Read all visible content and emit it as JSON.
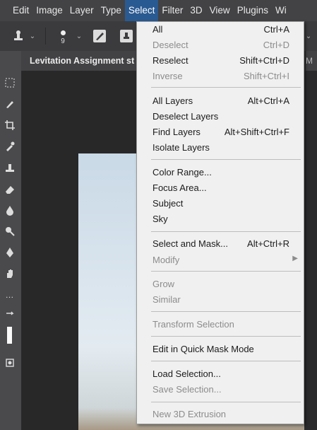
{
  "menubar": {
    "items": [
      "Edit",
      "Image",
      "Layer",
      "Type",
      "Select",
      "Filter",
      "3D",
      "View",
      "Plugins",
      "Wi"
    ],
    "active": "Select"
  },
  "options_bar": {
    "brush_size": "9"
  },
  "document": {
    "tab_title": "Levitation Assignment st",
    "tab_right": "M"
  },
  "select_menu": {
    "items": [
      {
        "label": "All",
        "shortcut": "Ctrl+A",
        "enabled": true
      },
      {
        "label": "Deselect",
        "shortcut": "Ctrl+D",
        "enabled": false
      },
      {
        "label": "Reselect",
        "shortcut": "Shift+Ctrl+D",
        "enabled": true
      },
      {
        "label": "Inverse",
        "shortcut": "Shift+Ctrl+I",
        "enabled": false
      },
      {
        "label": "All Layers",
        "shortcut": "Alt+Ctrl+A",
        "enabled": true
      },
      {
        "label": "Deselect Layers",
        "shortcut": "",
        "enabled": true
      },
      {
        "label": "Find Layers",
        "shortcut": "Alt+Shift+Ctrl+F",
        "enabled": true
      },
      {
        "label": "Isolate Layers",
        "shortcut": "",
        "enabled": true
      },
      {
        "label": "Color Range...",
        "shortcut": "",
        "enabled": true
      },
      {
        "label": "Focus Area...",
        "shortcut": "",
        "enabled": true
      },
      {
        "label": "Subject",
        "shortcut": "",
        "enabled": true
      },
      {
        "label": "Sky",
        "shortcut": "",
        "enabled": true
      },
      {
        "label": "Select and Mask...",
        "shortcut": "Alt+Ctrl+R",
        "enabled": true
      },
      {
        "label": "Modify",
        "shortcut": "",
        "enabled": false,
        "submenu": true
      },
      {
        "label": "Grow",
        "shortcut": "",
        "enabled": false
      },
      {
        "label": "Similar",
        "shortcut": "",
        "enabled": false
      },
      {
        "label": "Transform Selection",
        "shortcut": "",
        "enabled": false
      },
      {
        "label": "Edit in Quick Mask Mode",
        "shortcut": "",
        "enabled": true
      },
      {
        "label": "Load Selection...",
        "shortcut": "",
        "enabled": true
      },
      {
        "label": "Save Selection...",
        "shortcut": "",
        "enabled": false
      },
      {
        "label": "New 3D Extrusion",
        "shortcut": "",
        "enabled": false
      }
    ]
  },
  "icons": {
    "submenu_arrow": "chevron-right-icon",
    "tools": [
      "marquee-icon",
      "brush-icon",
      "crop-icon",
      "eyedropper-icon",
      "stamp-icon",
      "eraser-icon",
      "blur-icon",
      "dodge-icon",
      "pen-icon",
      "hand-icon",
      "more-icon",
      "swap-colors-icon",
      "foreground-color-icon",
      "quick-mask-icon"
    ]
  }
}
